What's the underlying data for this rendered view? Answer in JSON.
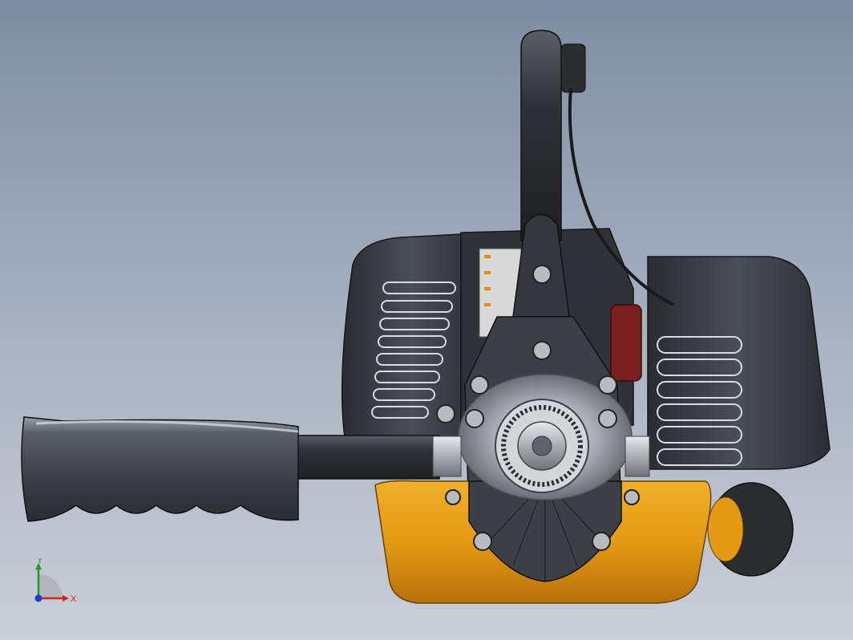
{
  "viewport": {
    "background_top": "#7f8da2",
    "background_bottom": "#c9cfd8"
  },
  "model": {
    "housing_color": "#e39a12",
    "body_color": "#3a3d42",
    "metal_color": "#b9bcc0",
    "accent_color": "#7a1f1f"
  },
  "triad": {
    "x_label": "X",
    "y_label": "Y",
    "x_color": "#d62020",
    "y_color": "#1f9a2a",
    "z_color": "#1c3fd0"
  }
}
